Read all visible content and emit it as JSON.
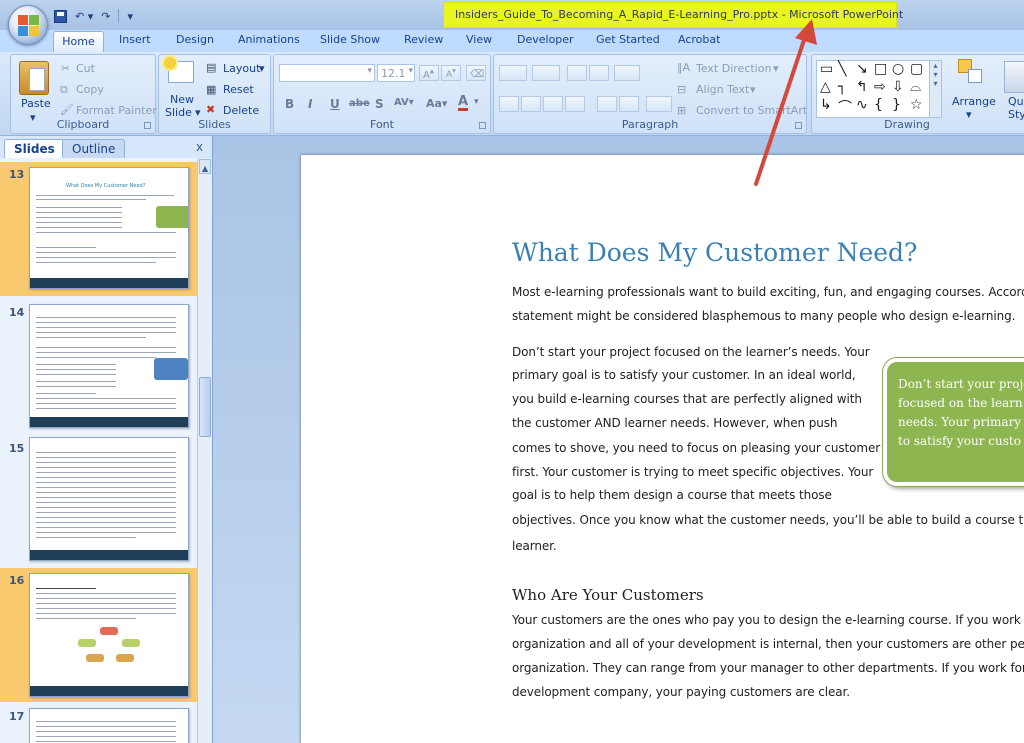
{
  "titlebar": {
    "title": "Insiders_Guide_To_Becoming_A_Rapid_E-Learning_Pro.pptx - Microsoft PowerPoint"
  },
  "ribbon": {
    "tabs": [
      "Home",
      "Insert",
      "Design",
      "Animations",
      "Slide Show",
      "Review",
      "View",
      "Developer",
      "Get Started",
      "Acrobat"
    ],
    "clipboard": {
      "label": "Clipboard",
      "paste": "Paste",
      "cut": "Cut",
      "copy": "Copy",
      "format_painter": "Format Painter"
    },
    "slides": {
      "label": "Slides",
      "new_slide_1": "New",
      "new_slide_2": "Slide",
      "layout": "Layout",
      "reset": "Reset",
      "delete": "Delete"
    },
    "font": {
      "label": "Font",
      "font_name": "",
      "font_size": "12.1"
    },
    "paragraph": {
      "label": "Paragraph",
      "text_direction": "Text Direction",
      "align_text": "Align Text",
      "convert_smartart": "Convert to SmartArt"
    },
    "drawing": {
      "label": "Drawing",
      "arrange": "Arrange",
      "quick_styles_1": "Quick",
      "quick_styles_2": "Styles"
    }
  },
  "slides_panel": {
    "tab_slides": "Slides",
    "tab_outline": "Outline",
    "close": "x",
    "slides": [
      {
        "number": "13",
        "title": "What Does My Customer Need?",
        "selected": true
      },
      {
        "number": "14",
        "title": "",
        "selected": false
      },
      {
        "number": "15",
        "title": "",
        "selected": false
      },
      {
        "number": "16",
        "title": "",
        "selected": true
      },
      {
        "number": "17",
        "title": "",
        "selected": false
      }
    ]
  },
  "slide": {
    "title": "What Does My Customer Need?",
    "intro_lines": [
      "Most e-learning professionals want to build exciting, fun, and engaging courses.  According",
      "statement might be considered blasphemous to many people who design e-learning."
    ],
    "para2_lines": [
      "Don’t start your project focused on the learner’s needs.  Your",
      "primary goal is to satisfy your customer.  In an ideal world,",
      "you build e-learning courses that are perfectly aligned with",
      "the customer AND learner needs.  However, when push",
      "comes to shove, you need to focus on pleasing your customer",
      "first.  Your customer is trying to meet specific objectives.  Your",
      "goal is to help them design a course that meets those",
      "objectives.  Once you know what the customer needs, you’ll be able to build a course that",
      "learner."
    ],
    "callout_lines": [
      "Don’t start your proje",
      "focused on the learn",
      "needs.  Your primary",
      "to satisfy your custo"
    ],
    "section_heading": "Who Are Your Customers",
    "section_lines": [
      "Your customers are the ones who pay you to design the e-learning course.  If you work for",
      "organization and all of your development is internal, then your customers are other peopl",
      "organization.  They can range from your manager to other departments.  If you work for a",
      "development company, your paying customers are clear."
    ]
  },
  "annotation": {
    "arrow_color": "#d3493d"
  },
  "colors": {
    "title_highlight": "#e8f520",
    "slide_title": "#3a80b5",
    "callout": "#8db650",
    "selected_slide": "#f9c970"
  }
}
